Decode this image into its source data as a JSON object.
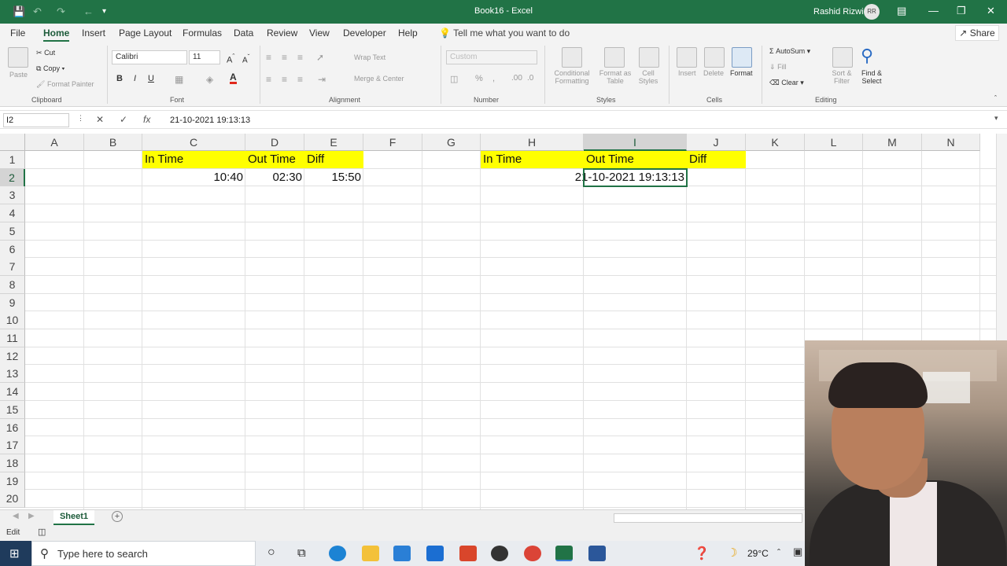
{
  "titlebar": {
    "title": "Book16 - Excel",
    "user": "Rashid Rizwi",
    "initials": "RR"
  },
  "menu": {
    "tabs": [
      "File",
      "Home",
      "Insert",
      "Page Layout",
      "Formulas",
      "Data",
      "Review",
      "View",
      "Developer",
      "Help"
    ],
    "tell_me": "Tell me what you want to do",
    "share": "Share"
  },
  "ribbon": {
    "clipboard": {
      "paste": "Paste",
      "cut": "Cut",
      "copy": "Copy",
      "format_painter": "Format Painter",
      "label": "Clipboard"
    },
    "font": {
      "name": "Calibri",
      "size": "11",
      "label": "Font"
    },
    "alignment": {
      "wrap": "Wrap Text",
      "merge": "Merge & Center",
      "label": "Alignment"
    },
    "number": {
      "format": "Custom",
      "label": "Number"
    },
    "styles": {
      "cond": "Conditional Formatting",
      "table": "Format as Table",
      "cell": "Cell Styles",
      "label": "Styles"
    },
    "cells": {
      "insert": "Insert",
      "delete": "Delete",
      "format": "Format",
      "label": "Cells"
    },
    "editing": {
      "autosum": "AutoSum",
      "fill": "Fill",
      "clear": "Clear",
      "sort": "Sort & Filter",
      "find": "Find & Select",
      "label": "Editing"
    }
  },
  "formula_bar": {
    "name_box": "I2",
    "value": "21-10-2021  19:13:13"
  },
  "columns": [
    "A",
    "B",
    "C",
    "D",
    "E",
    "F",
    "G",
    "H",
    "I",
    "J",
    "K",
    "L",
    "M",
    "N"
  ],
  "rows": [
    "1",
    "2",
    "3",
    "4",
    "5",
    "6",
    "7",
    "8",
    "9",
    "10",
    "11",
    "12",
    "13",
    "14",
    "15",
    "16",
    "17",
    "18",
    "19",
    "20"
  ],
  "cells": {
    "C1": "In Time",
    "D1": "Out Time",
    "E1": "Diff",
    "C2": "10:40",
    "D2": "02:30",
    "E2": "15:50",
    "H1": "In Time",
    "I1": "Out Time",
    "J1": "Diff",
    "I2": "21-10-2021  19:13:13"
  },
  "sheet": {
    "tab": "Sheet1"
  },
  "status": {
    "mode": "Edit"
  },
  "taskbar": {
    "search": "Type here to search",
    "temp": "29°C"
  },
  "colors": {
    "excel_green": "#217346",
    "highlight": "#ffff00"
  }
}
